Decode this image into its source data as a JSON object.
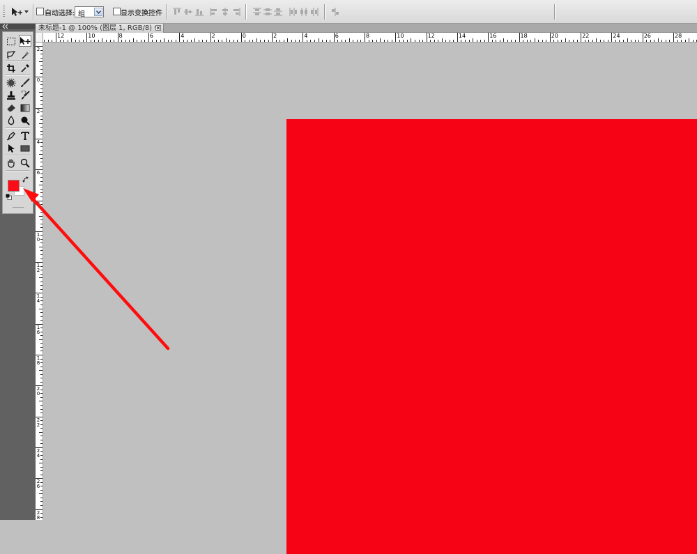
{
  "options_bar": {
    "auto_select_label": "自动选择:",
    "auto_select_value": "组",
    "show_transform_label": "显示变换控件"
  },
  "document": {
    "tab_title": "未标题-1 @ 100% (图层 1, RGB/8) *"
  },
  "ruler": {
    "top_labels": [
      "12",
      "10",
      "8",
      "6",
      "4",
      "2",
      "0",
      "2",
      "4",
      "6",
      "8",
      "10",
      "12",
      "14",
      "16",
      "18",
      "20",
      "22",
      "24",
      "26",
      "28"
    ],
    "left_labels": [
      "2",
      "0",
      "2",
      "4",
      "6",
      "8",
      "1\n0",
      "1\n2",
      "1\n4",
      "1\n6",
      "1\n8",
      "2\n0",
      "2\n2",
      "2\n4",
      "2\n6",
      "2\n8"
    ]
  },
  "colors": {
    "foreground": "#ff0b17",
    "background": "#ffffff",
    "canvas_fill": "#f60315",
    "workspace": "#c0c0c0",
    "annotation_arrow": "#ff0c0c"
  },
  "tools": [
    "rectangular-marquee-icon",
    "move-icon",
    "lasso-icon",
    "magic-wand-icon",
    "crop-icon",
    "eyedropper-icon",
    "spot-healing-icon",
    "brush-icon",
    "clone-stamp-icon",
    "history-brush-icon",
    "eraser-icon",
    "gradient-icon",
    "blur-icon",
    "dodge-icon",
    "pen-icon",
    "type-icon",
    "path-selection-icon",
    "rectangle-shape-icon",
    "hand-icon",
    "zoom-icon"
  ]
}
